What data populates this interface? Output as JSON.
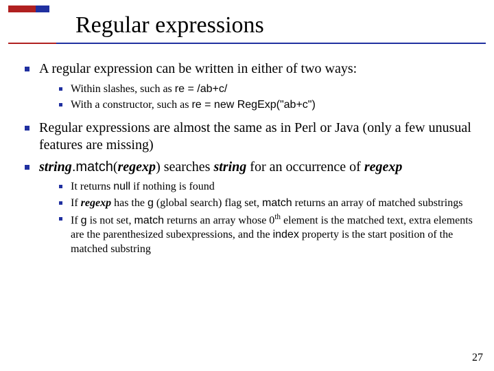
{
  "title": "Regular expressions",
  "page_number": "27",
  "b1": {
    "text": "A regular expression can be written in either of two ways:",
    "sub": {
      "a": {
        "prefix": "Within slashes, such as ",
        "code": "re = /ab+c/"
      },
      "b": {
        "prefix": "With a constructor, such as ",
        "code": "re = new RegExp(\"ab+c\")"
      }
    }
  },
  "b2": {
    "text": "Regular expressions are almost the same as in Perl or Java (only a few unusual features are missing)"
  },
  "b3": {
    "string_word": "string",
    "dot": ".",
    "match_word": "match",
    "open": "(",
    "regexp_word": "regexp",
    "close": ")",
    "mid": " searches ",
    "string_word2": "string",
    "tail": " for an occurrence of ",
    "regexp_word2": "regexp",
    "sub": {
      "a": {
        "p1": "It returns ",
        "null_word": "null",
        "p2": " if nothing is found"
      },
      "b": {
        "p1": "If ",
        "regexp_word": "regexp",
        "p2": " has the ",
        "g_word": "g",
        "p3": " (global search) flag set, ",
        "match_word": "match",
        "p4": " returns an array of matched substrings"
      },
      "c": {
        "p1": "If ",
        "g_word": "g",
        "p2": " is not set, ",
        "match_word": "match",
        "p3": " returns an array whose 0",
        "th": "th",
        "p4": " element is the matched text, extra elements are the parenthesized subexpressions, and the ",
        "index_word": "index",
        "p5": " property is the start position of the matched substring"
      }
    }
  }
}
